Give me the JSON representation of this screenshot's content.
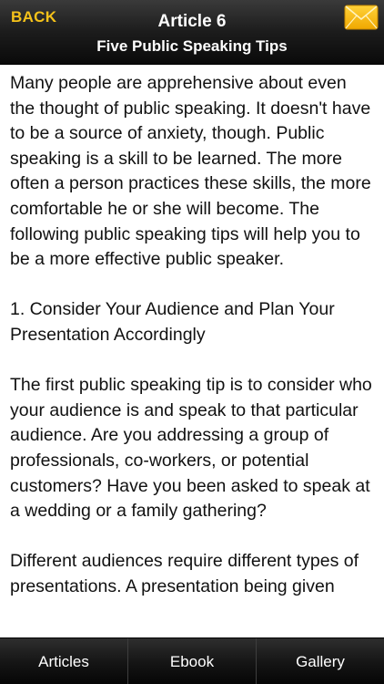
{
  "header": {
    "back_label": "BACK",
    "title": "Article 6",
    "subtitle": "Five Public Speaking Tips",
    "accent_color": "#f5c21a"
  },
  "article": {
    "paragraphs": [
      "Many people are apprehensive about even the thought of public speaking. It doesn't have to be a source of anxiety, though. Public speaking is a skill to be learned. The more often a person practices these skills, the more comfortable he or she will become. The following public speaking tips will help you to be a more effective public speaker.",
      "1. Consider Your Audience and Plan Your Presentation Accordingly",
      "The first public speaking tip is to consider who your audience is and speak to that particular audience. Are you addressing a group of professionals, co-workers, or potential customers? Have you been asked to speak at a wedding or a family gathering?",
      "Different audiences require different types of presentations. A presentation being given"
    ]
  },
  "tabbar": {
    "tabs": [
      {
        "label": "Articles"
      },
      {
        "label": "Ebook"
      },
      {
        "label": "Gallery"
      }
    ]
  },
  "icons": {
    "mail": "mail-envelope-icon"
  }
}
